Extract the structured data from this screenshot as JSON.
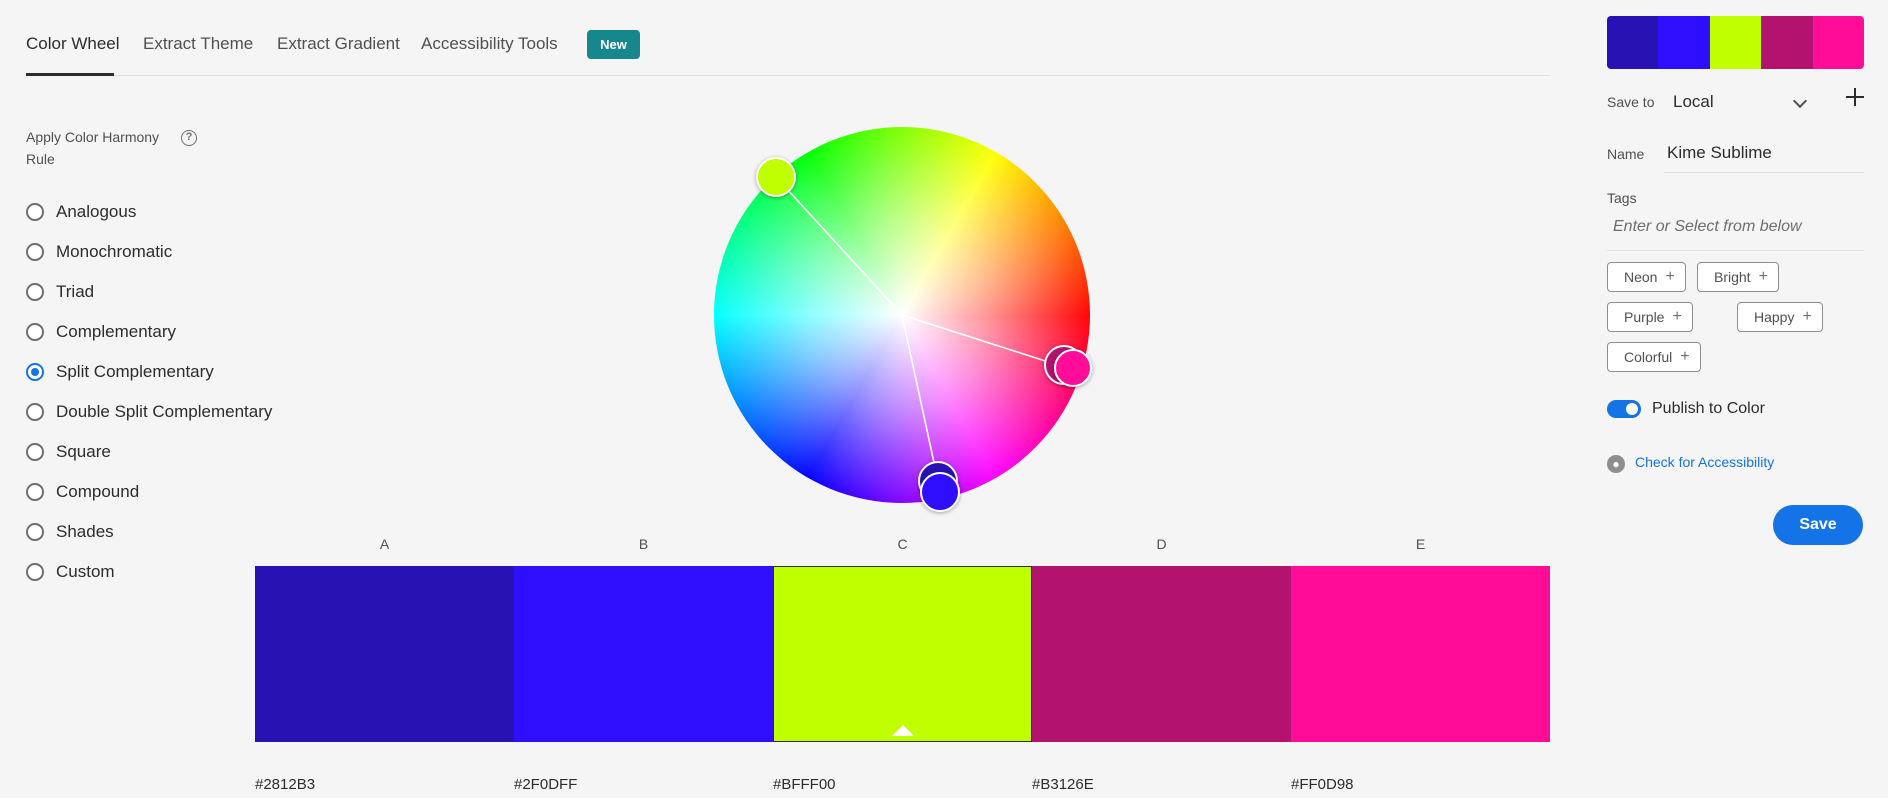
{
  "tabs": [
    {
      "label": "Color Wheel",
      "active": true
    },
    {
      "label": "Extract Theme",
      "active": false
    },
    {
      "label": "Extract Gradient",
      "active": false
    },
    {
      "label": "Accessibility Tools",
      "active": false
    }
  ],
  "badge": "New",
  "harmony": {
    "title": "Apply Color Harmony Rule",
    "help_icon": "question-circle-icon",
    "help_glyph": "?",
    "rules": [
      {
        "label": "Analogous",
        "checked": false
      },
      {
        "label": "Monochromatic",
        "checked": false
      },
      {
        "label": "Triad",
        "checked": false
      },
      {
        "label": "Complementary",
        "checked": false
      },
      {
        "label": "Split Complementary",
        "checked": true
      },
      {
        "label": "Double Split Complementary",
        "checked": false
      },
      {
        "label": "Square",
        "checked": false
      },
      {
        "label": "Compound",
        "checked": false
      },
      {
        "label": "Shades",
        "checked": false
      },
      {
        "label": "Custom",
        "checked": false
      }
    ]
  },
  "swatches": [
    {
      "letter": "A",
      "hex": "#2812B3"
    },
    {
      "letter": "B",
      "hex": "#2F0DFF"
    },
    {
      "letter": "C",
      "hex": "#BFFF00"
    },
    {
      "letter": "D",
      "hex": "#B3126E"
    },
    {
      "letter": "E",
      "hex": "#FF0D98"
    }
  ],
  "selected_swatch": "C",
  "panel": {
    "save_to_label": "Save to",
    "save_to_value": "Local",
    "name_label": "Name",
    "name_value": "Kime Sublime",
    "tags_label": "Tags",
    "tags_placeholder": "Enter or Select from below",
    "tags": [
      "Neon",
      "Bright",
      "Purple",
      "Happy",
      "Colorful"
    ],
    "tag_plus": "+",
    "publish_label": "Publish to Color",
    "publish_on": true,
    "a11y_icon": "accessibility-icon",
    "a11y_link": "Check for Accessibility",
    "save_button": "Save"
  },
  "colors": {
    "accent": "#1473e6",
    "badge": "#16878c"
  }
}
